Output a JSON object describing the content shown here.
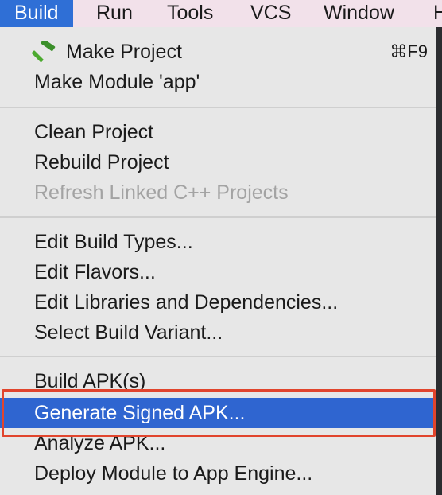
{
  "menubar": {
    "items": [
      {
        "label": "Build",
        "active": true
      },
      {
        "label": "Run"
      },
      {
        "label": "Tools"
      },
      {
        "label": "VCS"
      },
      {
        "label": "Window"
      },
      {
        "label": "H"
      }
    ]
  },
  "dropdown": {
    "make_project": {
      "label": "Make Project",
      "shortcut": "⌘F9",
      "icon": "hammer-icon"
    },
    "make_module": {
      "label": "Make Module 'app'"
    },
    "clean_project": {
      "label": "Clean Project"
    },
    "rebuild_project": {
      "label": "Rebuild Project"
    },
    "refresh_linked": {
      "label": "Refresh Linked C++ Projects",
      "enabled": false
    },
    "edit_build_types": {
      "label": "Edit Build Types..."
    },
    "edit_flavors": {
      "label": "Edit Flavors..."
    },
    "edit_libraries": {
      "label": "Edit Libraries and Dependencies..."
    },
    "select_build_variant": {
      "label": "Select Build Variant..."
    },
    "build_apk": {
      "label": "Build APK(s)"
    },
    "generate_signed_apk": {
      "label": "Generate Signed APK...",
      "highlighted": true
    },
    "analyze_apk": {
      "label": "Analyze APK..."
    },
    "deploy_module": {
      "label": "Deploy Module to App Engine..."
    }
  },
  "colors": {
    "menubar_bg": "#f2e1ea",
    "active_menu_bg": "#2f6fd6",
    "dropdown_bg": "#e7e7e7",
    "highlight_bg": "#2f65d0",
    "disabled_text": "#a3a3a3",
    "annotation_border": "#e1452d"
  }
}
